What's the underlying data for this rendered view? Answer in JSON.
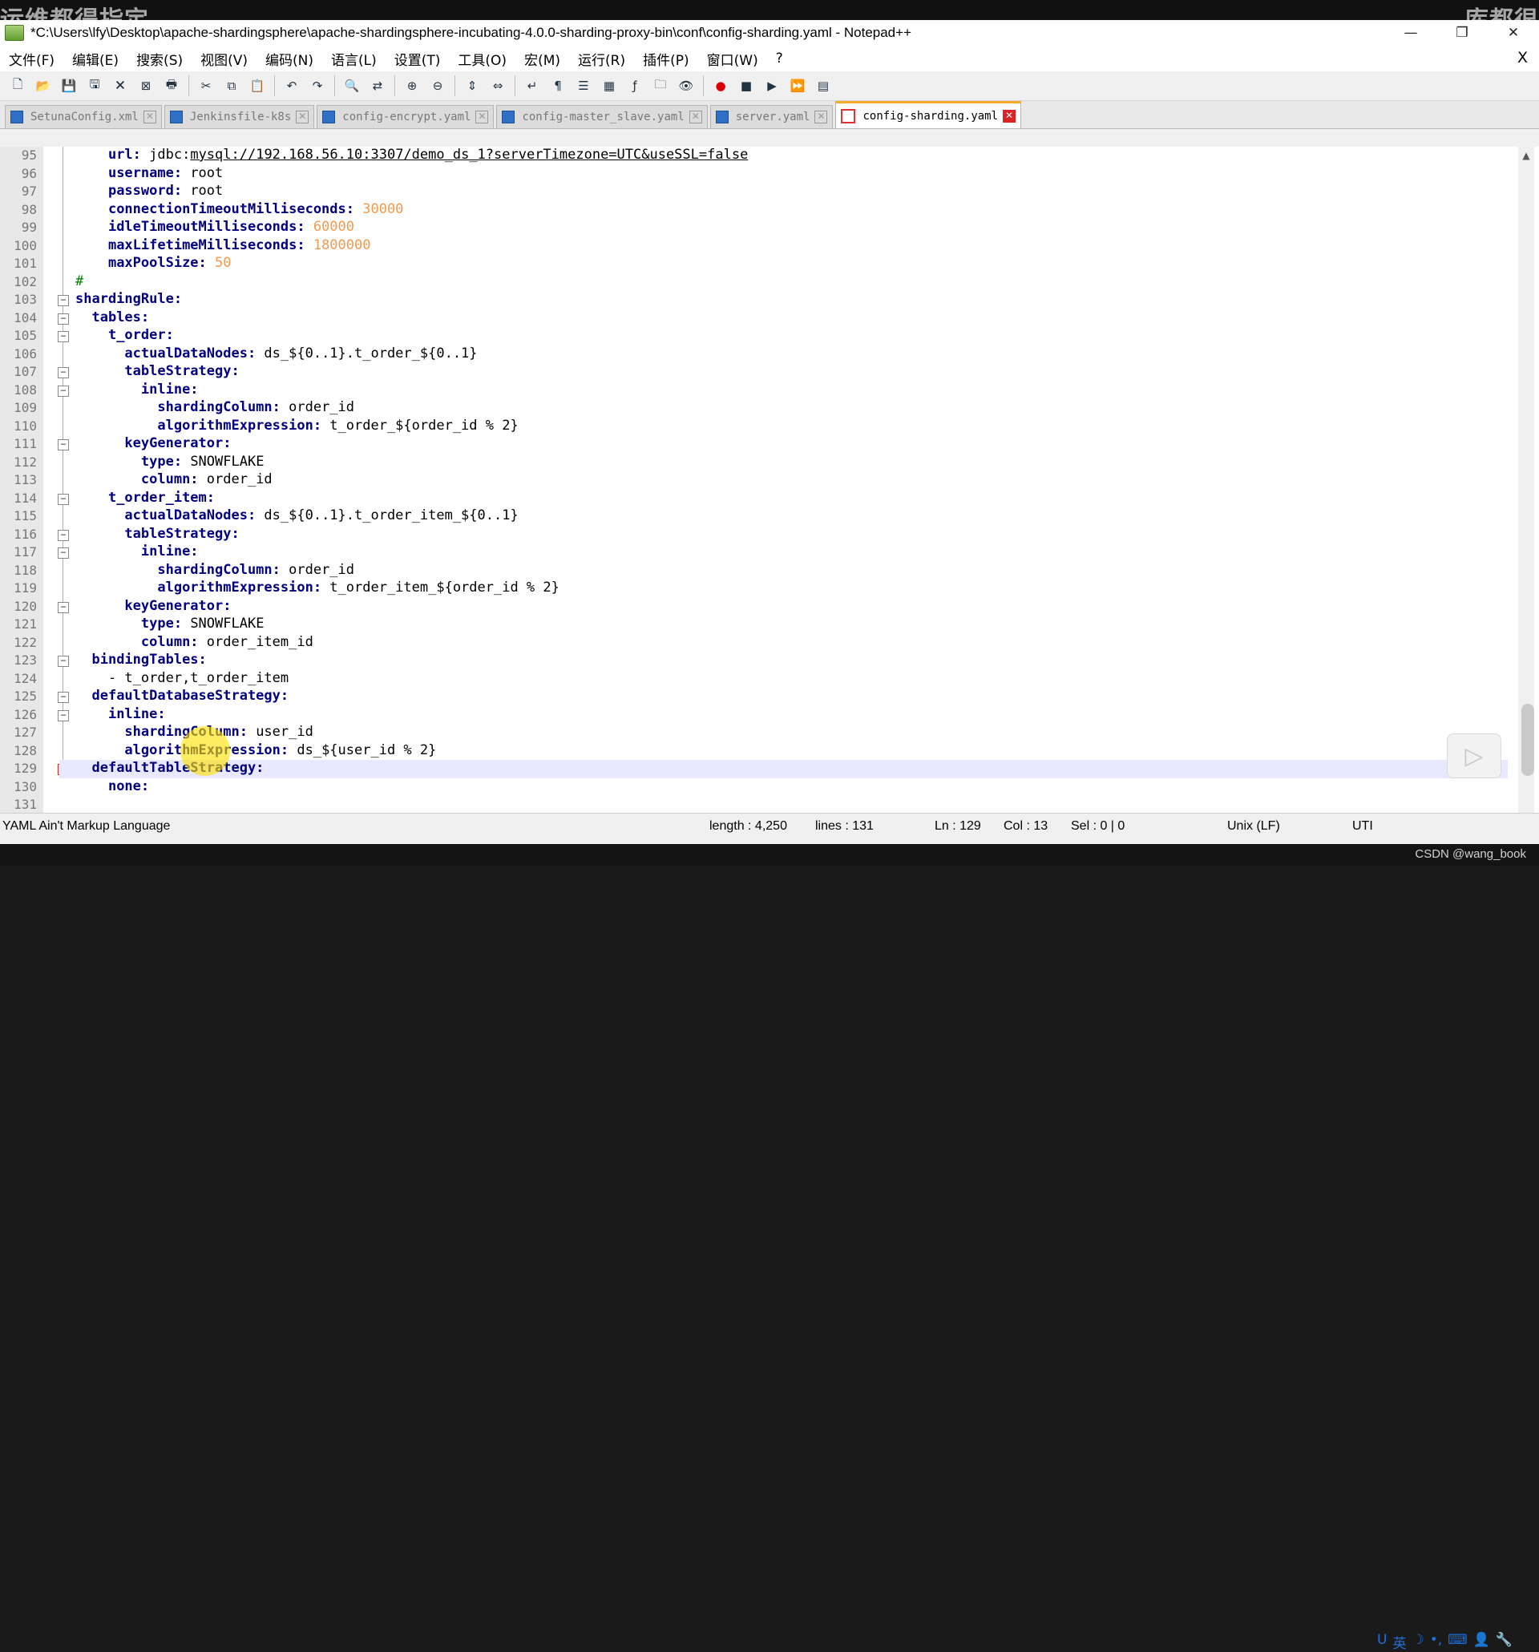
{
  "watermark": {
    "left": "运维都得指定",
    "right": "库都很"
  },
  "window": {
    "title": "*C:\\Users\\lfy\\Desktop\\apache-shardingsphere\\apache-shardingsphere-incubating-4.0.0-sharding-proxy-bin\\conf\\config-sharding.yaml - Notepad++",
    "minimize": "—",
    "maximize": "❐",
    "close": "✕"
  },
  "menus": [
    "文件(F)",
    "编辑(E)",
    "搜索(S)",
    "视图(V)",
    "编码(N)",
    "语言(L)",
    "设置(T)",
    "工具(O)",
    "宏(M)",
    "运行(R)",
    "插件(P)",
    "窗口(W)",
    "?"
  ],
  "menu_close": "X",
  "toolbar_icons": [
    "new-file-icon",
    "open-file-icon",
    "save-icon",
    "save-all-icon",
    "close-icon",
    "close-all-icon",
    "print-icon",
    "|",
    "cut-icon",
    "copy-icon",
    "paste-icon",
    "|",
    "undo-icon",
    "redo-icon",
    "|",
    "find-icon",
    "replace-icon",
    "|",
    "zoom-in-icon",
    "zoom-out-icon",
    "|",
    "sync-vertical-icon",
    "sync-horizontal-icon",
    "|",
    "word-wrap-icon",
    "show-all-chars-icon",
    "indent-guide-icon",
    "doc-map-icon",
    "function-list-icon",
    "folder-workspace-icon",
    "monitor-icon",
    "|",
    "record-macro-icon",
    "stop-macro-icon",
    "play-macro-icon",
    "run-macro-multiple-icon",
    "save-macro-icon"
  ],
  "tabs": [
    {
      "label": "SetunaConfig.xml",
      "active": false
    },
    {
      "label": "Jenkinsfile-k8s",
      "active": false
    },
    {
      "label": "config-encrypt.yaml",
      "active": false
    },
    {
      "label": "config-master_slave.yaml",
      "active": false
    },
    {
      "label": "server.yaml",
      "active": false
    },
    {
      "label": "config-sharding.yaml",
      "active": true
    }
  ],
  "code_lines": [
    {
      "n": "95",
      "indent": "    ",
      "key": "url:",
      "val": " jdbc:",
      "url": "mysql://192.168.56.10:3307/demo_ds_1?serverTimezone=UTC&useSSL=false"
    },
    {
      "n": "96",
      "indent": "    ",
      "key": "username:",
      "val": " root"
    },
    {
      "n": "97",
      "indent": "    ",
      "key": "password:",
      "val": " root"
    },
    {
      "n": "98",
      "indent": "    ",
      "key": "connectionTimeoutMilliseconds:",
      "num": " 30000"
    },
    {
      "n": "99",
      "indent": "    ",
      "key": "idleTimeoutMilliseconds:",
      "num": " 60000"
    },
    {
      "n": "100",
      "indent": "    ",
      "key": "maxLifetimeMilliseconds:",
      "num": " 1800000"
    },
    {
      "n": "101",
      "indent": "    ",
      "key": "maxPoolSize:",
      "num": " 50"
    },
    {
      "n": "102",
      "indent": "",
      "comment": "#"
    },
    {
      "n": "103",
      "indent": "",
      "key": "shardingRule:"
    },
    {
      "n": "104",
      "indent": "  ",
      "key": "tables:"
    },
    {
      "n": "105",
      "indent": "    ",
      "key": "t_order:"
    },
    {
      "n": "106",
      "indent": "      ",
      "key": "actualDataNodes:",
      "val": " ds_${0..1}.t_order_${0..1}"
    },
    {
      "n": "107",
      "indent": "      ",
      "key": "tableStrategy:"
    },
    {
      "n": "108",
      "indent": "        ",
      "key": "inline:"
    },
    {
      "n": "109",
      "indent": "          ",
      "key": "shardingColumn:",
      "val": " order_id"
    },
    {
      "n": "110",
      "indent": "          ",
      "key": "algorithmExpression:",
      "val": " t_order_${order_id % 2}"
    },
    {
      "n": "111",
      "indent": "      ",
      "key": "keyGenerator:"
    },
    {
      "n": "112",
      "indent": "        ",
      "key": "type:",
      "val": " SNOWFLAKE"
    },
    {
      "n": "113",
      "indent": "        ",
      "key": "column:",
      "val": " order_id"
    },
    {
      "n": "114",
      "indent": "    ",
      "key": "t_order_item:"
    },
    {
      "n": "115",
      "indent": "      ",
      "key": "actualDataNodes:",
      "val": " ds_${0..1}.t_order_item_${0..1}"
    },
    {
      "n": "116",
      "indent": "      ",
      "key": "tableStrategy:"
    },
    {
      "n": "117",
      "indent": "        ",
      "key": "inline:"
    },
    {
      "n": "118",
      "indent": "          ",
      "key": "shardingColumn:",
      "val": " order_id"
    },
    {
      "n": "119",
      "indent": "          ",
      "key": "algorithmExpression:",
      "val": " t_order_item_${order_id % 2}"
    },
    {
      "n": "120",
      "indent": "      ",
      "key": "keyGenerator:"
    },
    {
      "n": "121",
      "indent": "        ",
      "key": "type:",
      "val": " SNOWFLAKE"
    },
    {
      "n": "122",
      "indent": "        ",
      "key": "column:",
      "val": " order_item_id"
    },
    {
      "n": "123",
      "indent": "  ",
      "key": "bindingTables:"
    },
    {
      "n": "124",
      "indent": "    ",
      "val": "- t_order,t_order_item"
    },
    {
      "n": "125",
      "indent": "  ",
      "key": "defaultDatabaseStrategy:"
    },
    {
      "n": "126",
      "indent": "    ",
      "key": "inline:"
    },
    {
      "n": "127",
      "indent": "      ",
      "key": "shardingColumn:",
      "val": " user_id"
    },
    {
      "n": "128",
      "indent": "      ",
      "key": "algorithmExpression:",
      "val": " ds_${user_id % 2}"
    },
    {
      "n": "129",
      "indent": "  ",
      "key": "defaultTableStrategy:",
      "current": true
    },
    {
      "n": "130",
      "indent": "    ",
      "key": "none:"
    },
    {
      "n": "131",
      "indent": ""
    }
  ],
  "fold_lines": [
    "103",
    "104",
    "105",
    "107",
    "108",
    "111",
    "114",
    "116",
    "117",
    "120",
    "123",
    "125",
    "126",
    "129"
  ],
  "status": {
    "language": "YAML Ain't Markup Language",
    "length": "length : 4,250",
    "lines": "lines : 131",
    "ln": "Ln : 129",
    "col": "Col : 13",
    "sel": "Sel : 0 | 0",
    "eol": "Unix (LF)",
    "encoding": "UTI"
  },
  "ime_icons": [
    "U",
    "英",
    "☽",
    "•,",
    "⌨",
    "👤",
    "🔧"
  ],
  "credit": "CSDN @wang_book",
  "play_badge": "▷"
}
